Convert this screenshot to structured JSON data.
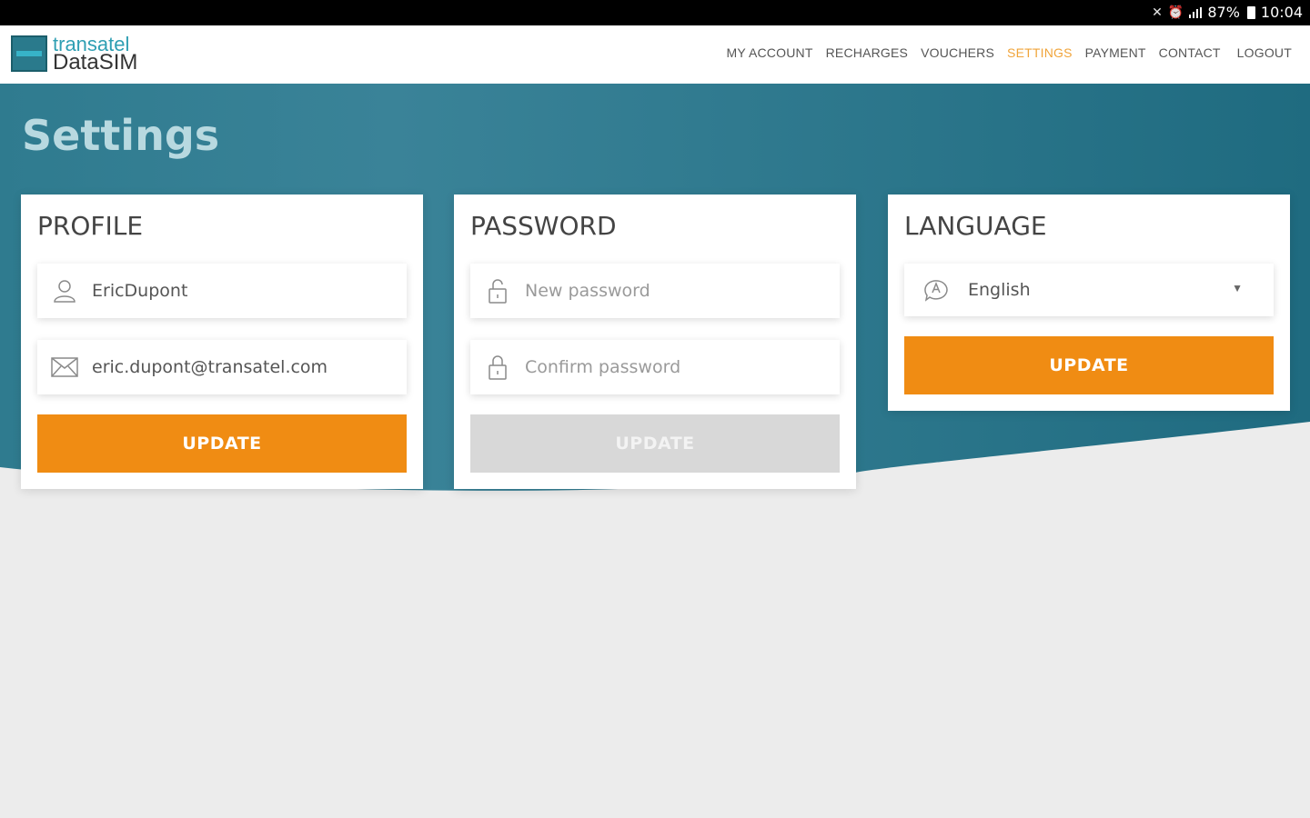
{
  "status_bar": {
    "battery": "87%",
    "time": "10:04"
  },
  "brand": {
    "line1": "transatel",
    "line2": "DataSIM"
  },
  "nav": [
    {
      "label": "MY ACCOUNT",
      "active": false
    },
    {
      "label": "RECHARGES",
      "active": false
    },
    {
      "label": "VOUCHERS",
      "active": false
    },
    {
      "label": "SETTINGS",
      "active": true
    },
    {
      "label": "PAYMENT",
      "active": false
    },
    {
      "label": "CONTACT",
      "active": false
    },
    {
      "label": "LOGOUT",
      "active": false
    }
  ],
  "page": {
    "title": "Settings"
  },
  "profile": {
    "title": "PROFILE",
    "username": "EricDupont",
    "email": "eric.dupont@transatel.com",
    "button": "UPDATE"
  },
  "password": {
    "title": "PASSWORD",
    "new_placeholder": "New password",
    "confirm_placeholder": "Confirm password",
    "button": "UPDATE",
    "button_disabled": true
  },
  "language": {
    "title": "LANGUAGE",
    "selected": "English",
    "button": "UPDATE"
  },
  "colors": {
    "teal": "#2a7388",
    "orange": "#f08c13",
    "nav_active": "#f0a43a"
  }
}
